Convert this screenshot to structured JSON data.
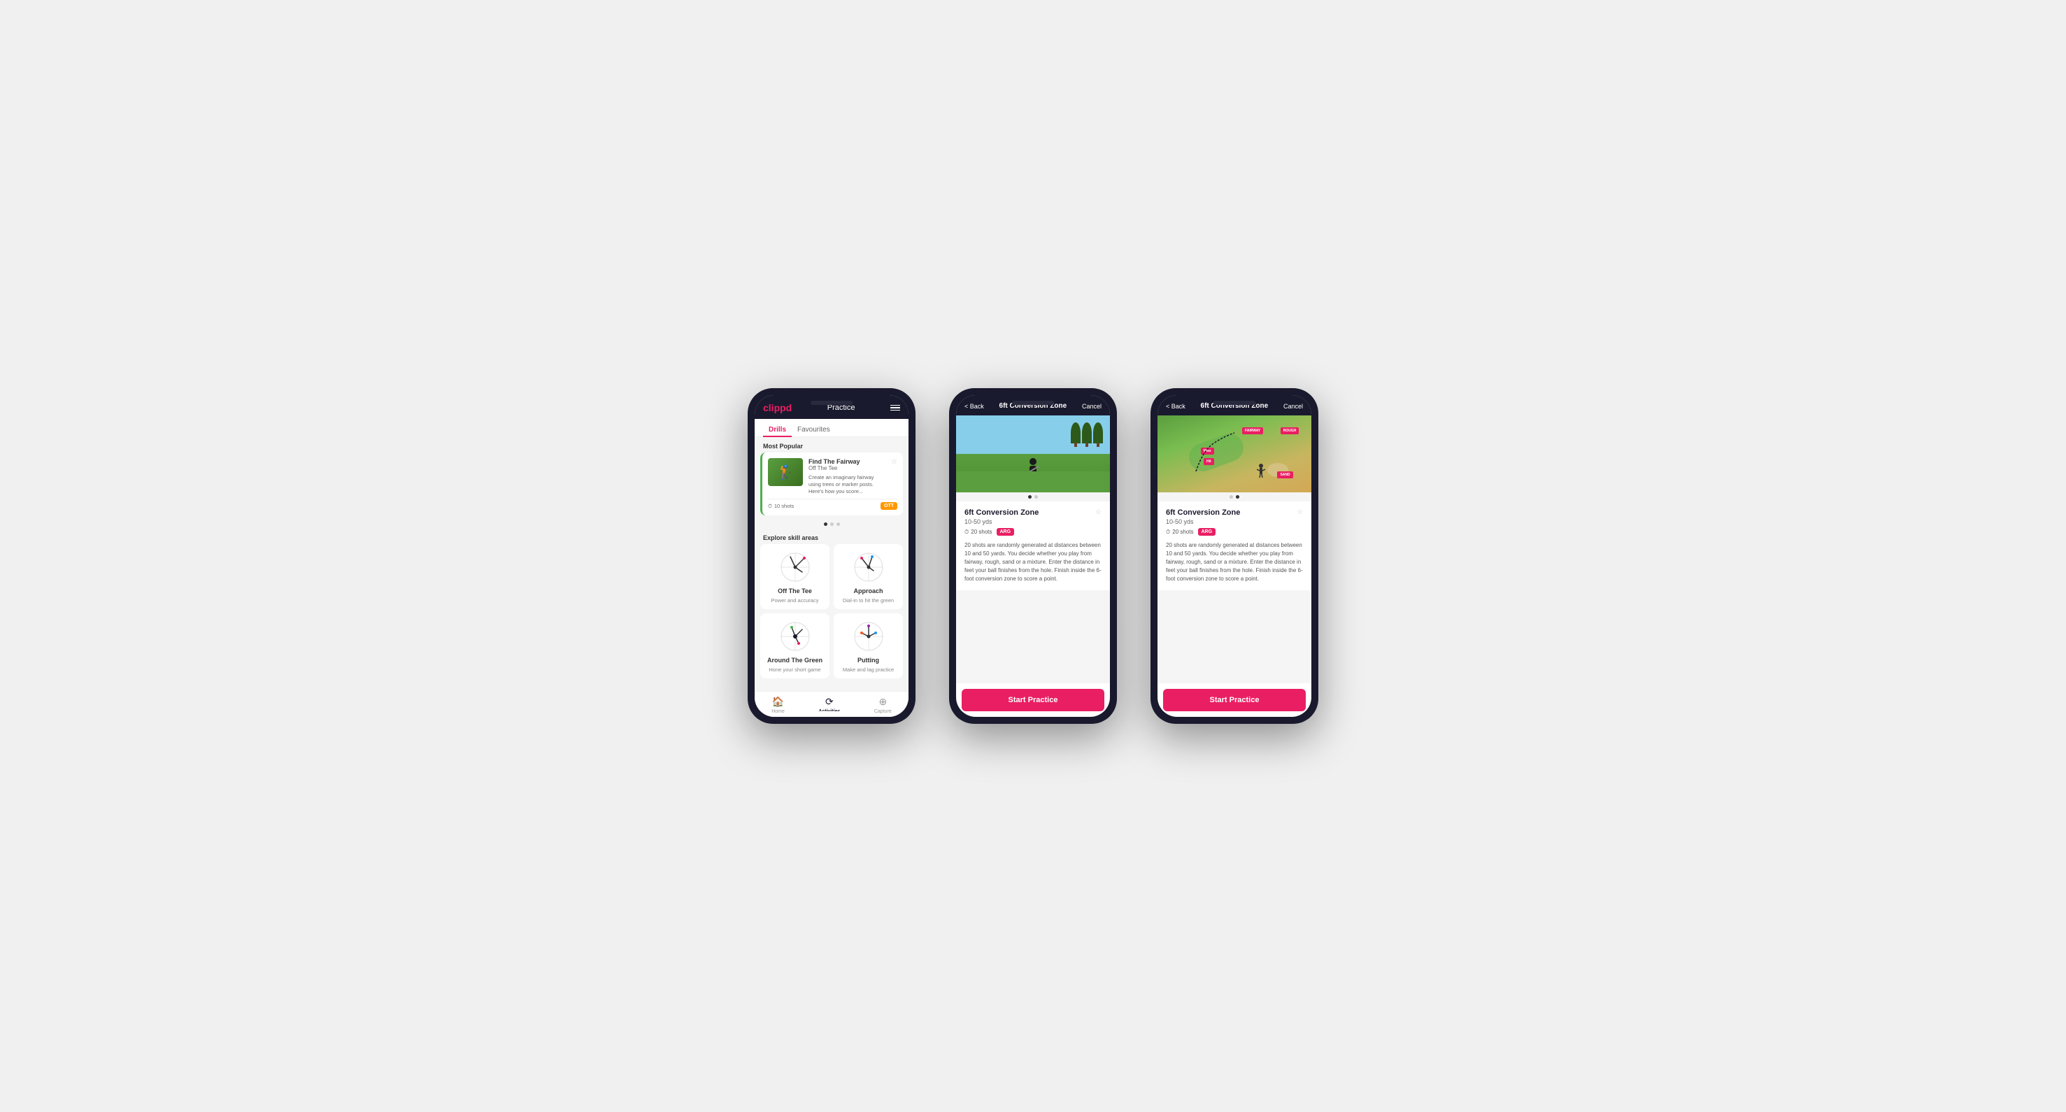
{
  "phone1": {
    "header": {
      "logo": "clippd",
      "title": "Practice"
    },
    "tabs": [
      {
        "label": "Drills",
        "active": true
      },
      {
        "label": "Favourites",
        "active": false
      }
    ],
    "most_popular_label": "Most Popular",
    "featured_drill": {
      "name": "Find The Fairway",
      "category": "Off The Tee",
      "description": "Create an imaginary fairway using trees or marker posts. Here's how you score...",
      "shots": "10 shots",
      "badge": "OTT"
    },
    "explore_label": "Explore skill areas",
    "skills": [
      {
        "name": "Off The Tee",
        "desc": "Power and accuracy"
      },
      {
        "name": "Approach",
        "desc": "Dial-in to hit the green"
      },
      {
        "name": "Around The Green",
        "desc": "Hone your short game"
      },
      {
        "name": "Putting",
        "desc": "Make and lag practice"
      }
    ],
    "nav": [
      {
        "label": "Home",
        "icon": "🏠"
      },
      {
        "label": "Activities",
        "icon": "♻",
        "active": true
      },
      {
        "label": "Capture",
        "icon": "➕"
      }
    ]
  },
  "phone2": {
    "header": {
      "back": "< Back",
      "title": "6ft Conversion Zone",
      "cancel": "Cancel"
    },
    "drill": {
      "title": "6ft Conversion Zone",
      "range": "10-50 yds",
      "shots": "20 shots",
      "badge": "ARG",
      "description": "20 shots are randomly generated at distances between 10 and 50 yards. You decide whether you play from fairway, rough, sand or a mixture. Enter the distance in feet your ball finishes from the hole. Finish inside the 6-foot conversion zone to score a point.",
      "fav_icon": "☆"
    },
    "cta": "Start Practice"
  },
  "phone3": {
    "header": {
      "back": "< Back",
      "title": "6ft Conversion Zone",
      "cancel": "Cancel"
    },
    "drill": {
      "title": "6ft Conversion Zone",
      "range": "10-50 yds",
      "shots": "20 shots",
      "badge": "ARG",
      "description": "20 shots are randomly generated at distances between 10 and 50 yards. You decide whether you play from fairway, rough, sand or a mixture. Enter the distance in feet your ball finishes from the hole. Finish inside the 6-foot conversion zone to score a point.",
      "fav_icon": "☆",
      "map_labels": [
        "Miss",
        "Hit",
        "FAIRWAY",
        "ROUGH",
        "SAND"
      ]
    },
    "cta": "Start Practice"
  }
}
